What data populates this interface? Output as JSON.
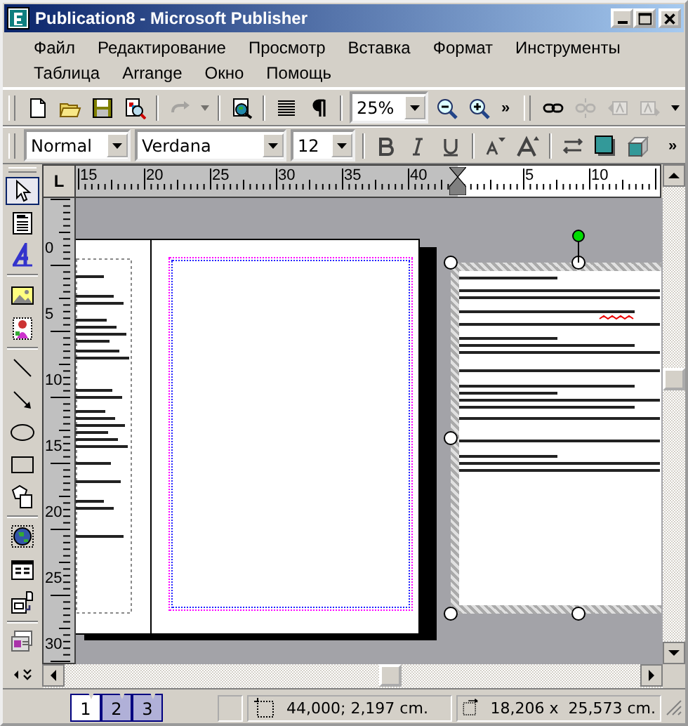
{
  "window": {
    "title": "Publication8 - Microsoft Publisher"
  },
  "menu_bar": [
    [
      "Файл",
      "Редактирование",
      "Просмотр",
      "Вставка",
      "Формат",
      "Инструменты"
    ],
    [
      "Таблица",
      "Arrange",
      "Окно",
      "Помощь"
    ]
  ],
  "standard_toolbar": {
    "buttons": [
      {
        "disabled": false
      },
      {
        "disabled": false
      },
      {
        "disabled": false
      },
      {
        "disabled": false
      },
      {
        "disabled": true
      },
      {
        "disabled": false
      },
      {
        "disabled": false
      },
      {
        "disabled": false
      }
    ],
    "zoom": "25%",
    "zoom_buttons": [
      {
        "disabled": false
      },
      {
        "disabled": false
      }
    ],
    "overflow": "»",
    "link_buttons": [
      {
        "disabled": false
      },
      {
        "disabled": true
      },
      {
        "disabled": true
      },
      {
        "disabled": true
      }
    ]
  },
  "formatting_toolbar": {
    "style": "Normal",
    "font": "Verdana",
    "size": "12",
    "overflow": "»"
  },
  "toolbox": [
    {
      "selected": true
    },
    {
      "selected": false
    },
    {
      "selected": false
    },
    {
      "selected": false
    },
    {
      "selected": false
    },
    {
      "selected": false
    },
    {
      "selected": false
    },
    {
      "selected": false
    },
    {
      "selected": false
    },
    {
      "selected": false
    },
    {
      "selected": false
    },
    {
      "selected": false
    },
    {
      "selected": false
    },
    {
      "selected": false
    }
  ],
  "ruler_corner": "L",
  "horizontal_ruler": [
    "15",
    "20",
    "25",
    "30",
    "35",
    "40",
    "5",
    "10"
  ],
  "vertical_ruler": [
    "0",
    "5",
    "10",
    "15",
    "20",
    "25",
    "30"
  ],
  "page_tabs": [
    {
      "label": "1",
      "selected": true
    },
    {
      "label": "2",
      "selected": false
    },
    {
      "label": "3",
      "selected": false
    }
  ],
  "status_bar": {
    "position": "44,000; 2,197 cm.",
    "size": "18,206 x  25,573 cm."
  }
}
